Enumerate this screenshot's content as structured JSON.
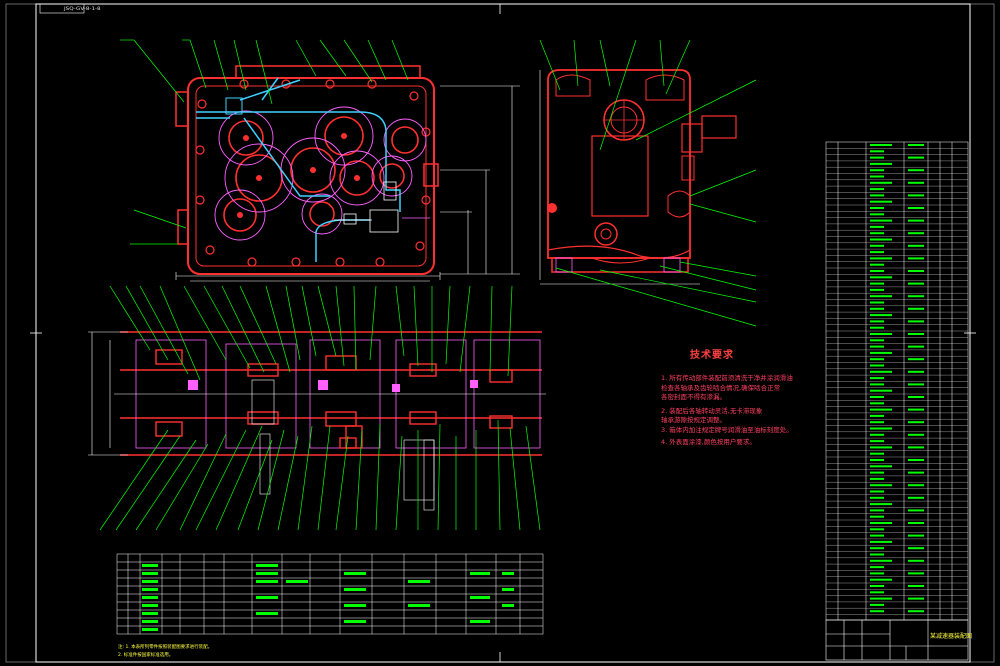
{
  "drawing": {
    "number": "JSQ-GV-8-1-8",
    "title": "某减速器装配图"
  },
  "technical_requirements": {
    "heading": "技术要求",
    "lines": [
      "1. 所有传动部件装配前须清洗干净并涂润滑油",
      "   检查各轴承及齿轮啮合情况,确保啮合正常",
      "   各密封面不得有渗漏。",
      "2. 装配后各轴转动灵活,无卡滞现象",
      "   轴承游隙按规定调整。",
      "3. 箱体内加注规定牌号润滑油至油标刻度处。",
      "4. 外表面涂漆,颜色按用户要求。"
    ]
  },
  "notes": [
    "注: 1. 本表所列零件按照装配图要求进行装配。",
    "    2. 标准件按国家标准选用。"
  ],
  "colors": {
    "background": "#000000",
    "frame": "#ffffff",
    "outline": "#ff3030",
    "leader": "#00ff00",
    "detail": "#ff60ff",
    "hidden": "#00ffff",
    "cyan_pipe": "#40d0ff",
    "text_yellow": "#ffff40",
    "dimension": "#ffffff"
  }
}
